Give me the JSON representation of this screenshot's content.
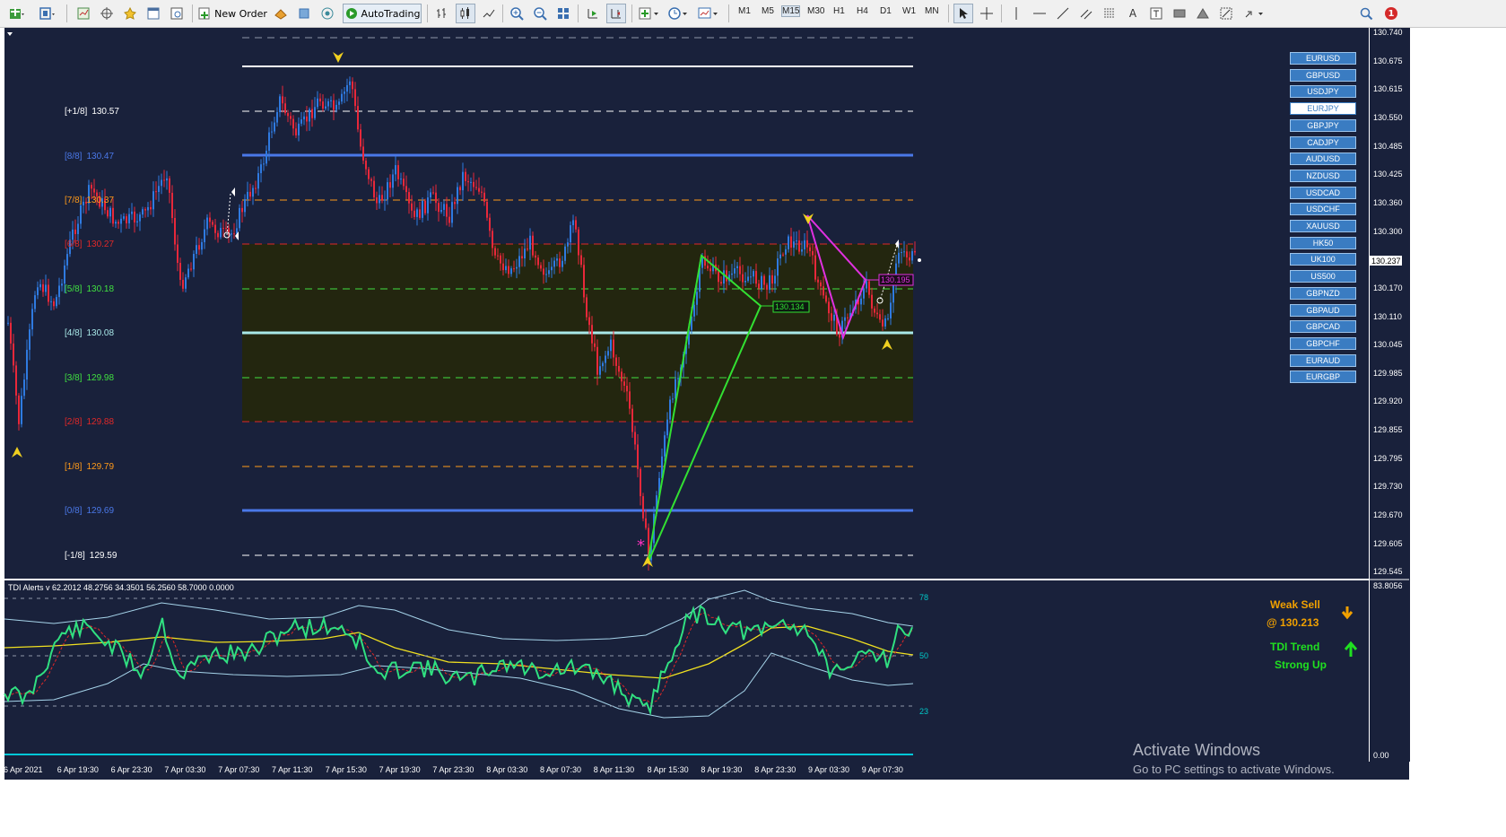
{
  "toolbar": {
    "new_order_label": "New Order",
    "autotrading_label": "AutoTrading",
    "timeframes": [
      "M1",
      "M5",
      "M15",
      "M30",
      "H1",
      "H4",
      "D1",
      "W1",
      "MN"
    ],
    "notification_count": "1",
    "tool_letter_label": "A"
  },
  "symbols": [
    {
      "name": "EURUSD",
      "active": false
    },
    {
      "name": "GBPUSD",
      "active": false
    },
    {
      "name": "USDJPY",
      "active": false
    },
    {
      "name": "EURJPY",
      "active": true
    },
    {
      "name": "GBPJPY",
      "active": false
    },
    {
      "name": "CADJPY",
      "active": false
    },
    {
      "name": "AUDUSD",
      "active": false
    },
    {
      "name": "NZDUSD",
      "active": false
    },
    {
      "name": "USDCAD",
      "active": false
    },
    {
      "name": "USDCHF",
      "active": false
    },
    {
      "name": "XAUUSD",
      "active": false
    },
    {
      "name": "HK50",
      "active": false
    },
    {
      "name": "UK100",
      "active": false
    },
    {
      "name": "US500",
      "active": false
    },
    {
      "name": "GBPNZD",
      "active": false
    },
    {
      "name": "GBPAUD",
      "active": false
    },
    {
      "name": "GBPCAD",
      "active": false
    },
    {
      "name": "GBPCHF",
      "active": false
    },
    {
      "name": "EURAUD",
      "active": false
    },
    {
      "name": "EURGBP",
      "active": false
    }
  ],
  "murrey_levels": [
    {
      "label": "[+1/8]",
      "value": "130.57",
      "color": "#ffffff"
    },
    {
      "label": "[8/8]",
      "value": "130.47",
      "color": "#4a78e8"
    },
    {
      "label": "[7/8]",
      "value": "130.37",
      "color": "#ff9a1a"
    },
    {
      "label": "[6/8]",
      "value": "130.27",
      "color": "#e02828"
    },
    {
      "label": "[5/8]",
      "value": "130.18",
      "color": "#40e040"
    },
    {
      "label": "[4/8]",
      "value": "130.08",
      "color": "#a8e8e8"
    },
    {
      "label": "[3/8]",
      "value": "129.98",
      "color": "#40e040"
    },
    {
      "label": "[2/8]",
      "value": "129.88",
      "color": "#e02828"
    },
    {
      "label": "[1/8]",
      "value": "129.79",
      "color": "#ff9a1a"
    },
    {
      "label": "[0/8]",
      "value": "129.69",
      "color": "#4a78e8"
    },
    {
      "label": "[-1/8]",
      "value": "129.59",
      "color": "#ffffff"
    }
  ],
  "price_axis": {
    "ticks": [
      "130.740",
      "130.675",
      "130.615",
      "130.550",
      "130.485",
      "130.425",
      "130.360",
      "130.300",
      "130.237",
      "130.170",
      "130.110",
      "130.045",
      "129.985",
      "129.920",
      "129.855",
      "129.795",
      "129.730",
      "129.670",
      "129.605",
      "129.545"
    ],
    "current_price": "130.237",
    "indicator_top": "83.8056",
    "indicator_bottom": "0.00"
  },
  "pattern_labels": {
    "green_target": "130.134",
    "magenta_target": "130.195"
  },
  "time_axis": [
    "6 Apr 2021",
    "6 Apr 19:30",
    "6 Apr 23:30",
    "7 Apr 03:30",
    "7 Apr 07:30",
    "7 Apr 11:30",
    "7 Apr 15:30",
    "7 Apr 19:30",
    "7 Apr 23:30",
    "8 Apr 03:30",
    "8 Apr 07:30",
    "8 Apr 11:30",
    "8 Apr 15:30",
    "8 Apr 19:30",
    "8 Apr 23:30",
    "9 Apr 03:30",
    "9 Apr 07:30"
  ],
  "tdi": {
    "title": "TDI Alerts v 62.2012 48.2756 34.3501 56.2560 58.7000 0.0000",
    "levels": [
      "78",
      "50",
      "23"
    ],
    "signal_line1": "Weak Sell",
    "signal_line2": "@ 130.213",
    "trend_line1": "TDI Trend",
    "trend_line2": "Strong Up"
  },
  "watermark": {
    "title": "Activate Windows",
    "subtitle": "Go to PC settings to activate Windows."
  }
}
